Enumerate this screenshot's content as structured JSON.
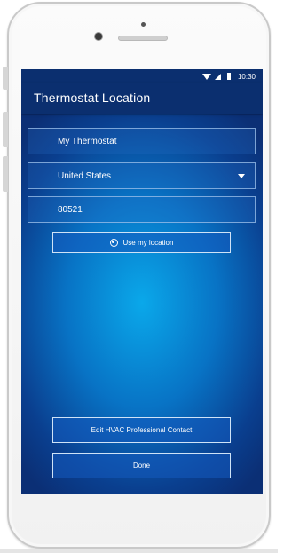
{
  "status_bar": {
    "time": "10:30"
  },
  "app_bar": {
    "title": "Thermostat Location"
  },
  "form": {
    "name_value": "My Thermostat",
    "country_value": "United States",
    "zip_value": "80521"
  },
  "buttons": {
    "use_location": "Use my location",
    "hvac_contact": "Edit HVAC Professional Contact",
    "done": "Done"
  },
  "icons": {
    "wifi": "wifi-icon",
    "signal": "signal-icon",
    "battery": "battery-icon",
    "dropdown": "chevron-down-icon",
    "location": "location-target-icon"
  },
  "colors": {
    "app_bar": "#0b2f6f",
    "screen_center": "#0aa8ea",
    "screen_edge": "#0b2f75",
    "field_border": "#a0c3eb"
  }
}
